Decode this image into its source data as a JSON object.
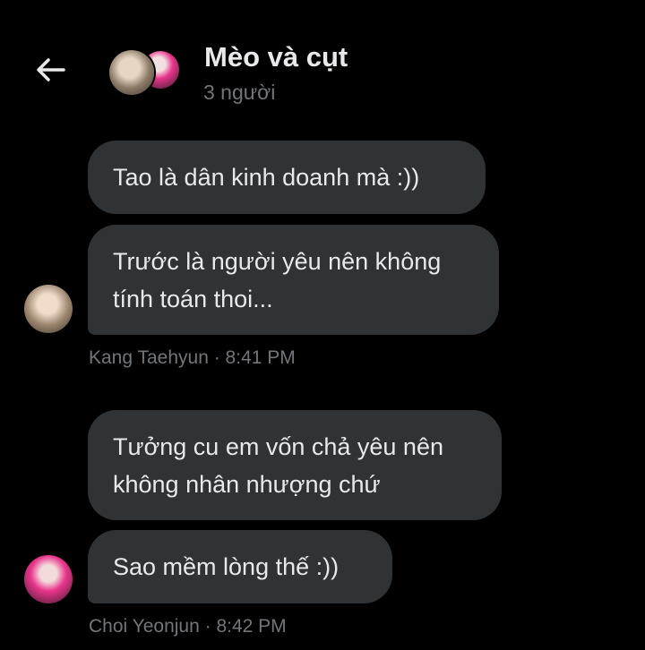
{
  "header": {
    "back_icon": "arrow-left-icon",
    "title": "Mèo và cụt",
    "subtitle": "3 người"
  },
  "messages": [
    {
      "text": "Tao là dân kinh doanh mà :))"
    },
    {
      "text_line1": "Trước là người yêu nên không",
      "text_line2": "tính toán thoi..."
    },
    {
      "text_line1": "Tưởng cu em vốn chả yêu nên",
      "text_line2": "không nhân nhượng chứ"
    },
    {
      "text": "Sao mềm lòng thế :))"
    }
  ],
  "meta": {
    "group1": "Kang Taehyun · 8:41 PM",
    "group2": "Choi Yeonjun · 8:42 PM"
  },
  "colors": {
    "background": "#000000",
    "bubble": "#2f3336",
    "text": "#e7e9ea",
    "muted": "#71767b"
  }
}
